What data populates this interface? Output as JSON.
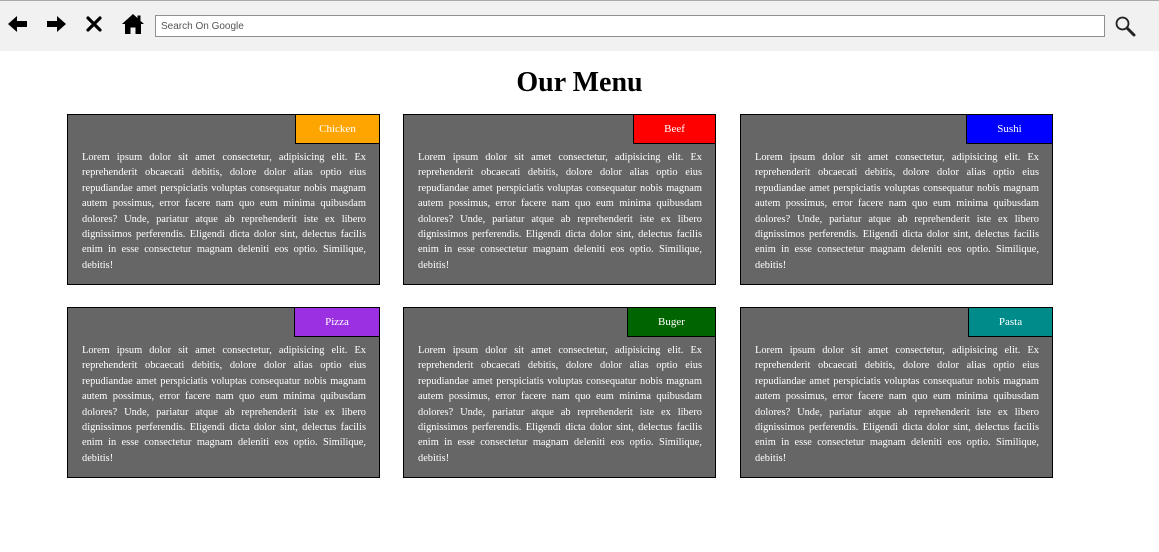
{
  "toolbar": {
    "icons": [
      "back-arrow-icon",
      "forward-arrow-icon",
      "close-icon",
      "home-icon",
      "search-icon"
    ],
    "search_placeholder": "Search On Google",
    "search_value": ""
  },
  "page": {
    "title": "Our Menu"
  },
  "menu": {
    "items": [
      {
        "label": "Chicken",
        "color": "#FFA500",
        "text": "Lorem ipsum dolor sit amet consectetur, adipisicing elit. Ex reprehenderit obcaecati debitis, dolore dolor alias optio eius repudiandae amet perspiciatis voluptas consequatur nobis magnam autem possimus, error facere nam quo eum minima quibusdam dolores? Unde, pariatur atque ab reprehenderit iste ex libero dignissimos perferendis. Eligendi dicta dolor sint, delectus facilis enim in esse consectetur magnam deleniti eos optio. Similique, debitis!"
      },
      {
        "label": "Beef",
        "color": "#FF0000",
        "text": "Lorem ipsum dolor sit amet consectetur, adipisicing elit. Ex reprehenderit obcaecati debitis, dolore dolor alias optio eius repudiandae amet perspiciatis voluptas consequatur nobis magnam autem possimus, error facere nam quo eum minima quibusdam dolores? Unde, pariatur atque ab reprehenderit iste ex libero dignissimos perferendis. Eligendi dicta dolor sint, delectus facilis enim in esse consectetur magnam deleniti eos optio. Similique, debitis!"
      },
      {
        "label": "Sushi",
        "color": "#0000FF",
        "text": "Lorem ipsum dolor sit amet consectetur, adipisicing elit. Ex reprehenderit obcaecati debitis, dolore dolor alias optio eius repudiandae amet perspiciatis voluptas consequatur nobis magnam autem possimus, error facere nam quo eum minima quibusdam dolores? Unde, pariatur atque ab reprehenderit iste ex libero dignissimos perferendis. Eligendi dicta dolor sint, delectus facilis enim in esse consectetur magnam deleniti eos optio. Similique, debitis!"
      },
      {
        "label": "Pizza",
        "color": "#9B30E3",
        "text": "Lorem ipsum dolor sit amet consectetur, adipisicing elit. Ex reprehenderit obcaecati debitis, dolore dolor alias optio eius repudiandae amet perspiciatis voluptas consequatur nobis magnam autem possimus, error facere nam quo eum minima quibusdam dolores? Unde, pariatur atque ab reprehenderit iste ex libero dignissimos perferendis. Eligendi dicta dolor sint, delectus facilis enim in esse consectetur magnam deleniti eos optio. Similique, debitis!"
      },
      {
        "label": "Buger",
        "color": "#006400",
        "text": "Lorem ipsum dolor sit amet consectetur, adipisicing elit. Ex reprehenderit obcaecati debitis, dolore dolor alias optio eius repudiandae amet perspiciatis voluptas consequatur nobis magnam autem possimus, error facere nam quo eum minima quibusdam dolores? Unde, pariatur atque ab reprehenderit iste ex libero dignissimos perferendis. Eligendi dicta dolor sint, delectus facilis enim in esse consectetur magnam deleniti eos optio. Similique, debitis!"
      },
      {
        "label": "Pasta",
        "color": "#008B8B",
        "text": "Lorem ipsum dolor sit amet consectetur, adipisicing elit. Ex reprehenderit obcaecati debitis, dolore dolor alias optio eius repudiandae amet perspiciatis voluptas consequatur nobis magnam autem possimus, error facere nam quo eum minima quibusdam dolores? Unde, pariatur atque ab reprehenderit iste ex libero dignissimos perferendis. Eligendi dicta dolor sint, delectus facilis enim in esse consectetur magnam deleniti eos optio. Similique, debitis!"
      }
    ]
  }
}
